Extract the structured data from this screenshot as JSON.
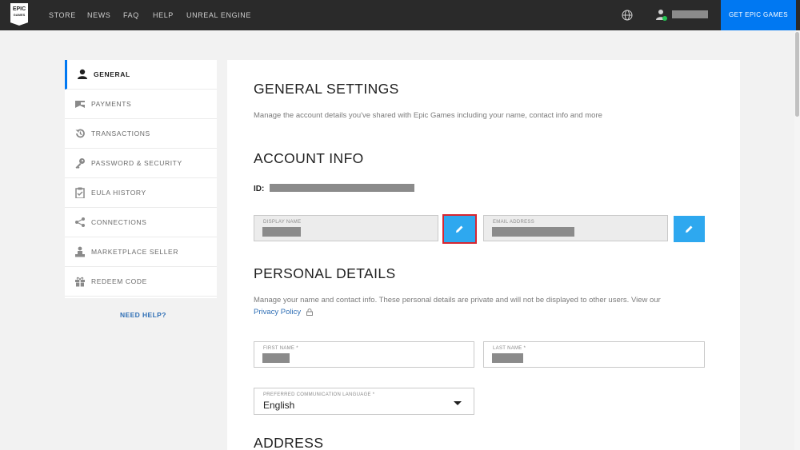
{
  "brand": {
    "logo_line1": "EPIC",
    "logo_line2": "GAMES"
  },
  "nav": {
    "items": [
      {
        "label": "STORE"
      },
      {
        "label": "NEWS"
      },
      {
        "label": "FAQ"
      },
      {
        "label": "HELP"
      },
      {
        "label": "UNREAL ENGINE"
      }
    ],
    "cta_label": "GET EPIC GAMES"
  },
  "sidebar": {
    "items": [
      {
        "label": "GENERAL",
        "icon": "person-icon",
        "active": true
      },
      {
        "label": "PAYMENTS",
        "icon": "wallet-icon"
      },
      {
        "label": "TRANSACTIONS",
        "icon": "history-icon"
      },
      {
        "label": "PASSWORD & SECURITY",
        "icon": "key-icon"
      },
      {
        "label": "EULA HISTORY",
        "icon": "clipboard-check-icon"
      },
      {
        "label": "CONNECTIONS",
        "icon": "share-icon"
      },
      {
        "label": "MARKETPLACE SELLER",
        "icon": "seller-icon"
      },
      {
        "label": "REDEEM CODE",
        "icon": "gift-icon"
      }
    ],
    "need_help": "NEED HELP?"
  },
  "main": {
    "title": "GENERAL SETTINGS",
    "description": "Manage the account details you've shared with Epic Games including your name, contact info and more",
    "account_info": {
      "heading": "ACCOUNT INFO",
      "id_label": "ID:",
      "display_name_label": "DISPLAY NAME",
      "email_label": "EMAIL ADDRESS"
    },
    "personal_details": {
      "heading": "PERSONAL DETAILS",
      "description": "Manage your name and contact info. These personal details are private and will not be displayed to other users. View our",
      "privacy_link": "Privacy Policy",
      "first_name_label": "FIRST NAME *",
      "last_name_label": "LAST NAME *",
      "language_label": "PREFERRED COMMUNICATION LANGUAGE *",
      "language_value": "English"
    },
    "address": {
      "heading": "ADDRESS"
    }
  },
  "colors": {
    "topbar": "#2a2a2a",
    "accent_blue": "#0078f2",
    "edit_button": "#2ea8ef",
    "highlight_border": "#d72631",
    "link": "#2f6fb5"
  }
}
